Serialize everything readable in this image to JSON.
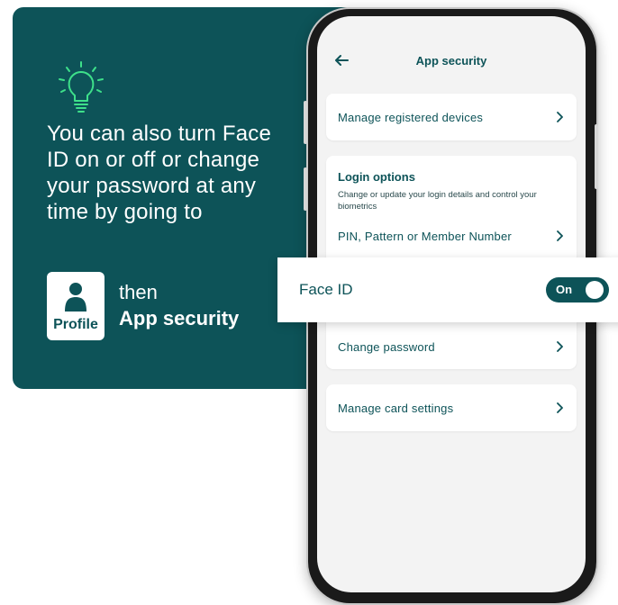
{
  "info": {
    "tip": "You can also turn Face ID on or off or change your password at any time by going to",
    "profile_label": "Profile",
    "then": "then",
    "app_security": "App security"
  },
  "screen": {
    "title": "App security",
    "manage_devices": "Manage registered devices",
    "login_options_title": "Login options",
    "login_options_desc": "Change or update your login details and control your biometrics",
    "pin_row": "PIN, Pattern or Member Number",
    "change_password": "Change password",
    "manage_card": "Manage card settings"
  },
  "face_id": {
    "label": "Face ID",
    "toggle_state": "On"
  },
  "colors": {
    "brand": "#0d5358",
    "accent_bulb": "#3ee08a"
  },
  "icons": [
    "lightbulb-icon",
    "person-icon",
    "back-arrow-icon",
    "chevron-right-icon"
  ]
}
